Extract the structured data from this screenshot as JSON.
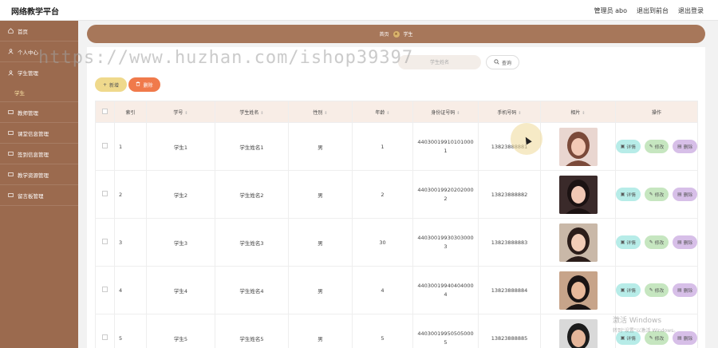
{
  "app": {
    "title": "网络教学平台"
  },
  "topbar": {
    "user": "管理员 abo",
    "to_front": "退出到前台",
    "logout": "退出登录"
  },
  "sidebar": {
    "items": [
      {
        "label": "首页",
        "icon": "home-icon"
      },
      {
        "label": "个人中心",
        "icon": "user-icon"
      },
      {
        "label": "学生管理",
        "icon": "users-icon"
      },
      {
        "label": "学生",
        "sub": true
      },
      {
        "label": "教师管理",
        "icon": "teacher-icon"
      },
      {
        "label": "课堂信息管理",
        "icon": "class-icon"
      },
      {
        "label": "签到信息管理",
        "icon": "checkin-icon"
      },
      {
        "label": "教学资源管理",
        "icon": "resource-icon"
      },
      {
        "label": "留言板管理",
        "icon": "message-icon"
      }
    ]
  },
  "breadcrumb": {
    "home": "首页",
    "current": "学生"
  },
  "search": {
    "placeholder": "学生姓名",
    "button": "查询"
  },
  "actions": {
    "add": "新增",
    "delete": "删除"
  },
  "table": {
    "headers": [
      "索引",
      "学号",
      "学生姓名",
      "性别",
      "年龄",
      "身份证号码",
      "手机号码",
      "相片",
      "操作"
    ],
    "row_actions": {
      "detail": "详情",
      "edit": "修改",
      "delete": "删除"
    },
    "rows": [
      {
        "index": "1",
        "student_no": "学生1",
        "name": "学生姓名1",
        "gender": "男",
        "age": "1",
        "id_line1": "44030019910101000",
        "id_line2": "1",
        "phone": "13823888881"
      },
      {
        "index": "2",
        "student_no": "学生2",
        "name": "学生姓名2",
        "gender": "男",
        "age": "2",
        "id_line1": "44030019920202000",
        "id_line2": "2",
        "phone": "13823888882"
      },
      {
        "index": "3",
        "student_no": "学生3",
        "name": "学生姓名3",
        "gender": "男",
        "age": "30",
        "id_line1": "44030019930303000",
        "id_line2": "3",
        "phone": "13823888883"
      },
      {
        "index": "4",
        "student_no": "学生4",
        "name": "学生姓名4",
        "gender": "男",
        "age": "4",
        "id_line1": "44030019940404000",
        "id_line2": "4",
        "phone": "13823888884"
      },
      {
        "index": "5",
        "student_no": "学生5",
        "name": "学生姓名5",
        "gender": "男",
        "age": "5",
        "id_line1": "44030019950505000",
        "id_line2": "5",
        "phone": "13823888885"
      }
    ]
  },
  "overlay": {
    "watermark": "https://www.huzhan.com/ishop39397",
    "windows_line1": "激活 Windows",
    "windows_line2": "转到\"设置\"以激活 Windows。"
  },
  "colors": {
    "sidebar": "#9b6a4e",
    "breadcrumb": "#a7775a",
    "detail": "#b7ece8",
    "edit": "#c6e6c0",
    "delete": "#d7bfe8"
  }
}
